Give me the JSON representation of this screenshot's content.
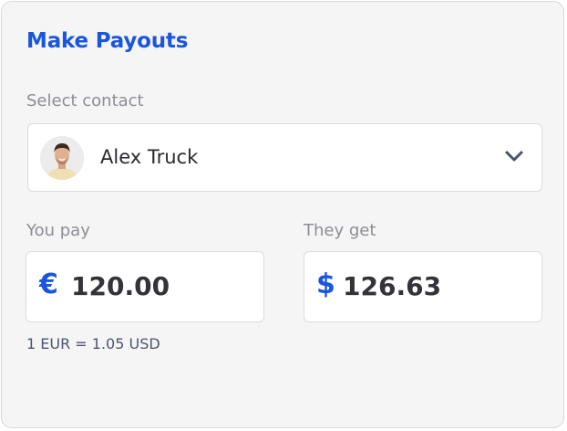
{
  "card": {
    "title": "Make Payouts",
    "contact": {
      "label": "Select contact",
      "selected_name": "Alex Truck"
    },
    "you_pay": {
      "label": "You pay",
      "currency_symbol": "€",
      "amount": "120.00"
    },
    "they_get": {
      "label": "They get",
      "currency_symbol": "$",
      "amount": "126.63"
    },
    "exchange_rate": "1 EUR = 1.05 USD"
  },
  "colors": {
    "accent": "#1a56db",
    "background": "#f5f5f6",
    "border": "#dcdce0"
  },
  "icons": {
    "dropdown": "chevron-down-icon",
    "avatar": "avatar"
  }
}
